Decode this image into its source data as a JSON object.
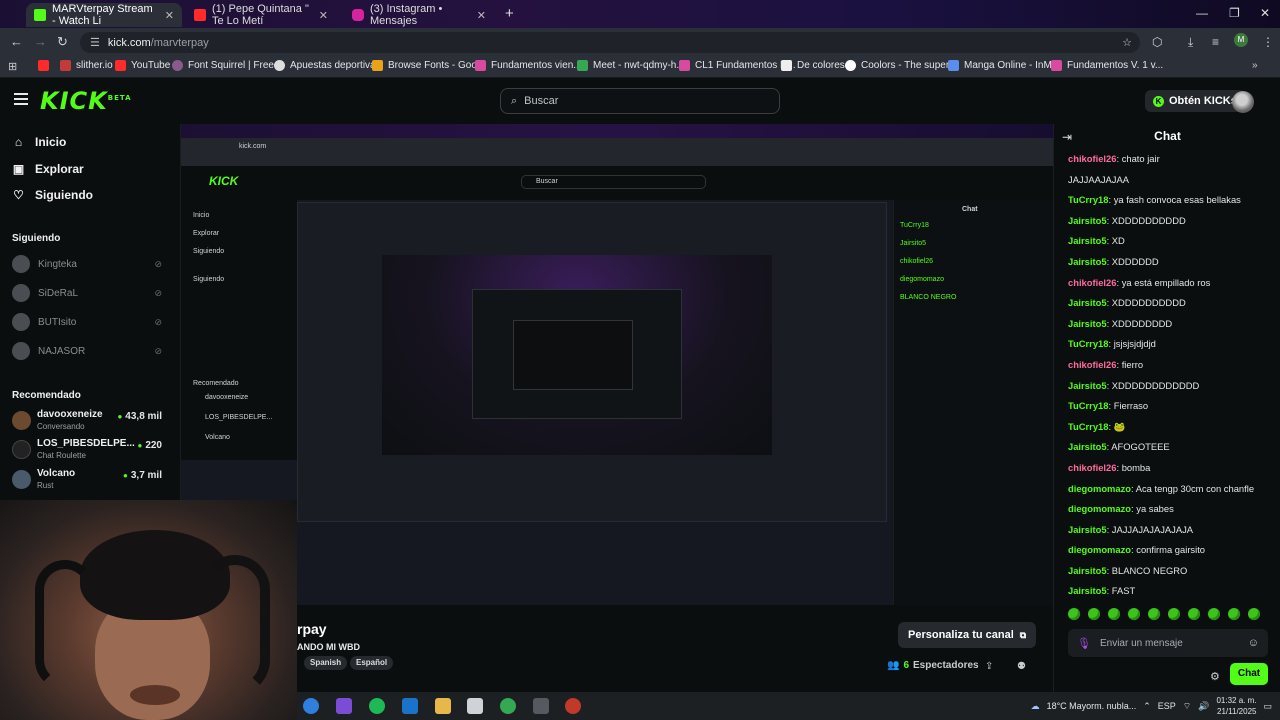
{
  "browser": {
    "tabs": [
      {
        "title": "MARVterpay Stream - Watch Li",
        "active": true,
        "icon_color": "#53fc18"
      },
      {
        "title": "(1) Pepe Quintana \" Te Lo Metí",
        "active": false,
        "icon_color": "#ff2a2a"
      },
      {
        "title": "(3) Instagram • Mensajes",
        "active": false,
        "icon_color": "#d6249f"
      }
    ],
    "url_host": "kick.com",
    "url_path": "/marvterpay",
    "bookmarks": [
      {
        "label": "",
        "color": "#ff2a2a"
      },
      {
        "label": "slither.io",
        "color": "#c23a3a"
      },
      {
        "label": "YouTube",
        "color": "#ff2a2a"
      },
      {
        "label": "Font Squirrel | Free...",
        "color": "#8a5a8a"
      },
      {
        "label": "Apuestas deportivas",
        "color": "#dddddd"
      },
      {
        "label": "Browse Fonts - Goo...",
        "color": "#e8a317"
      },
      {
        "label": "Fundamentos vien...",
        "color": "#d64aa0"
      },
      {
        "label": "Meet - nwt-qdmy-h...",
        "color": "#34a853"
      },
      {
        "label": "CL1 Fundamentos D...",
        "color": "#d64aa0"
      },
      {
        "label": "De colores",
        "color": "#eeeeee"
      },
      {
        "label": "Coolors - The super...",
        "color": "#ffffff"
      },
      {
        "label": "Manga Online - InM...",
        "color": "#5b8def"
      },
      {
        "label": "Fundamentos V. 1 v...",
        "color": "#d64aa0"
      }
    ]
  },
  "header": {
    "logo": "KICK",
    "logo_tm": "BETA",
    "search_placeholder": "Buscar",
    "kicks_button": "Obtén KICKs"
  },
  "sidebar": {
    "nav": [
      {
        "label": "Inicio",
        "icon": "home-icon"
      },
      {
        "label": "Explorar",
        "icon": "compass-icon"
      },
      {
        "label": "Siguiendo",
        "icon": "heart-icon"
      }
    ],
    "following_heading": "Siguiendo",
    "following": [
      "Kingteka",
      "SiDeRaL",
      "BUTIsito",
      "NAJASOR"
    ],
    "recommended_heading": "Recomendado",
    "recommended": [
      {
        "name": "davooxeneize",
        "category": "Conversando",
        "viewers": "43,8 mil"
      },
      {
        "name": "LOS_PIBESDELPE...",
        "category": "Chat Roulette",
        "viewers": "220"
      },
      {
        "name": "Volcano",
        "category": "Rust",
        "viewers": "3,7 mil"
      }
    ]
  },
  "stream": {
    "name": "rpay",
    "title": "ANDO MI WBD",
    "tags": [
      "Spanish",
      "Español"
    ],
    "personaliza": "Personaliza tu canal",
    "viewers_count": "6",
    "viewers_label": "Espectadores"
  },
  "chat": {
    "title": "Chat",
    "messages": [
      {
        "user": "chikofiel26",
        "color": "#ff6b9a",
        "text": "chato jair"
      },
      {
        "user": "",
        "color": "#53fc18",
        "text": "JAJJAAJAJAA"
      },
      {
        "user": "TuCrry18",
        "color": "#53fc18",
        "text": "ya fash convoca esas bellakas"
      },
      {
        "user": "Jairsito5",
        "color": "#53fc18",
        "text": "XDDDDDDDDDD"
      },
      {
        "user": "Jairsito5",
        "color": "#53fc18",
        "text": "XD"
      },
      {
        "user": "Jairsito5",
        "color": "#53fc18",
        "text": "XDDDDDD"
      },
      {
        "user": "chikofiel26",
        "color": "#ff6b9a",
        "text": "ya está empillado ros"
      },
      {
        "user": "Jairsito5",
        "color": "#53fc18",
        "text": "XDDDDDDDDDD"
      },
      {
        "user": "Jairsito5",
        "color": "#53fc18",
        "text": "XDDDDDDDD"
      },
      {
        "user": "TuCrry18",
        "color": "#53fc18",
        "text": "jsjsjsjdjdjd"
      },
      {
        "user": "chikofiel26",
        "color": "#ff6b9a",
        "text": "fierro"
      },
      {
        "user": "Jairsito5",
        "color": "#53fc18",
        "text": "XDDDDDDDDDDDD"
      },
      {
        "user": "TuCrry18",
        "color": "#53fc18",
        "text": "Fierraso"
      },
      {
        "user": "TuCrry18",
        "color": "#53fc18",
        "text": "🐸"
      },
      {
        "user": "Jairsito5",
        "color": "#53fc18",
        "text": "AFOGOTEEE"
      },
      {
        "user": "chikofiel26",
        "color": "#ff6b9a",
        "text": "bomba"
      },
      {
        "user": "diegomomazo",
        "color": "#53fc18",
        "text": "Aca tengp 30cm con chanfle"
      },
      {
        "user": "diegomomazo",
        "color": "#53fc18",
        "text": "ya sabes"
      },
      {
        "user": "Jairsito5",
        "color": "#53fc18",
        "text": "JAJJAJAJAJAJAJA"
      },
      {
        "user": "diegomomazo",
        "color": "#53fc18",
        "text": "confirma gairsito"
      },
      {
        "user": "Jairsito5",
        "color": "#53fc18",
        "text": "BLANCO NEGRO"
      },
      {
        "user": "Jairsito5",
        "color": "#53fc18",
        "text": "FAST"
      }
    ],
    "input_placeholder": "Enviar un mensaje",
    "send_button": "Chat"
  },
  "taskbar": {
    "weather": "18°C  Mayorm. nubla...",
    "lang": "ESP",
    "time": "01:32 a. m.",
    "date": "21/11/2025"
  },
  "colors": {
    "accent": "#53fc18",
    "bg": "#0b0e0f"
  }
}
